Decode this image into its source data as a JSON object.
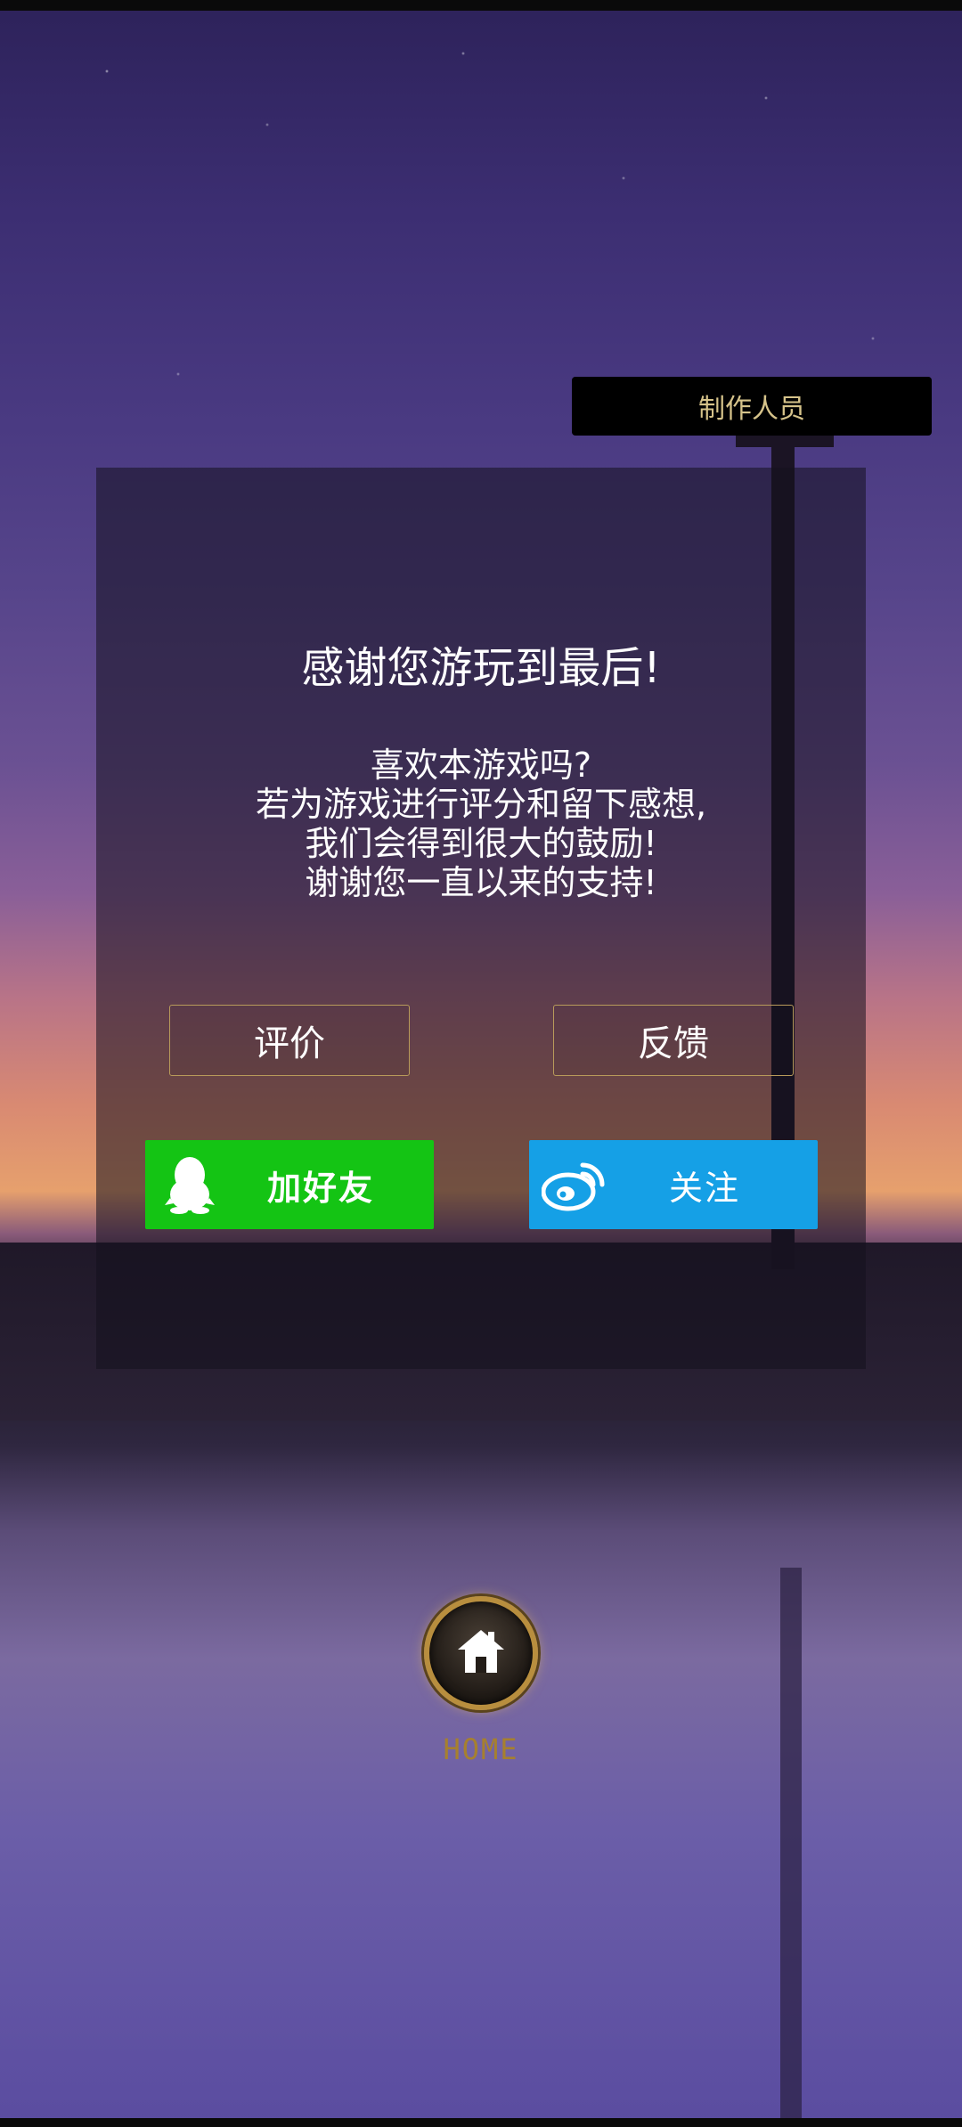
{
  "credits": {
    "label": "制作人员"
  },
  "dialog": {
    "title": "感谢您游玩到最后!",
    "message_lines": [
      "喜欢本游戏吗?",
      "若为游戏进行评分和留下感想,",
      "我们会得到很大的鼓励!",
      "谢谢您一直以来的支持!"
    ],
    "rate_label": "评价",
    "feedback_label": "反馈",
    "qq_label": "加好友",
    "weibo_label": "关注"
  },
  "home": {
    "label": "HOME"
  },
  "colors": {
    "qq_green": "#14c414",
    "weibo_blue": "#15a0e6",
    "gold": "#b89a5a",
    "credits_text": "#d6c38a"
  },
  "icons": {
    "qq": "qq-penguin-icon",
    "weibo": "weibo-icon",
    "home": "house-icon"
  }
}
